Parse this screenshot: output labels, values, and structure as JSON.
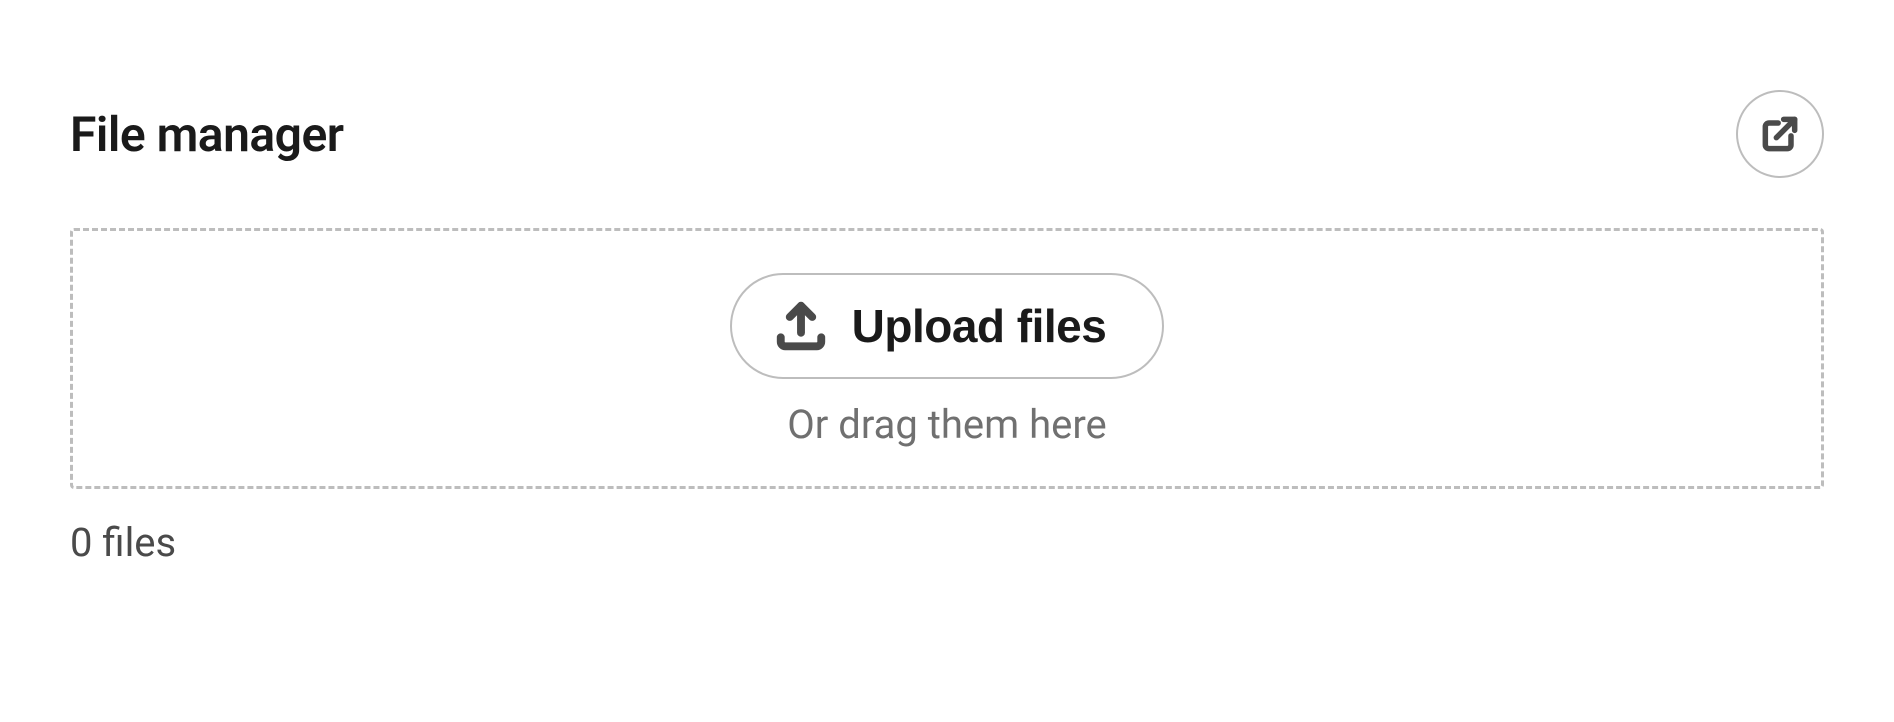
{
  "header": {
    "title": "File manager"
  },
  "dropzone": {
    "upload_button_label": "Upload files",
    "drag_hint": "Or drag them here"
  },
  "status": {
    "file_count_text": "0 files"
  }
}
